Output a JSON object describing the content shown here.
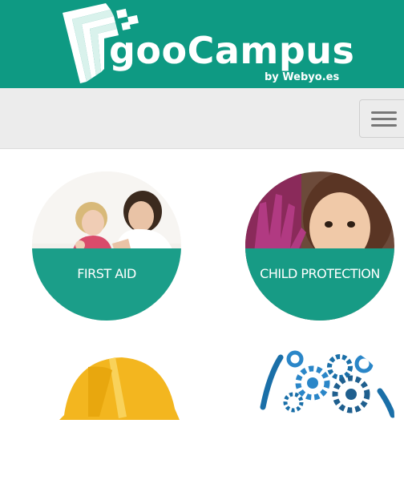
{
  "header": {
    "brand": "gooCampus",
    "byline": "by Webyo.es"
  },
  "navbar": {
    "menu_icon": "hamburger-icon"
  },
  "courses": [
    {
      "label": "FIRST AID"
    },
    {
      "label": "CHILD PROTECTION"
    }
  ],
  "colors": {
    "brand_green": "#0e9a83",
    "navbar_bg": "#ececec"
  }
}
